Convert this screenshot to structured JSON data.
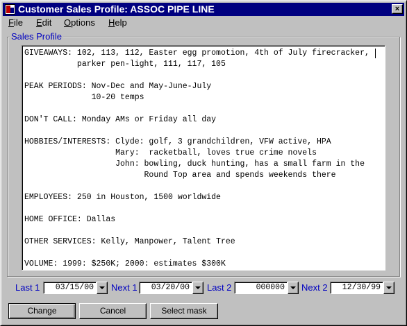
{
  "window": {
    "title": "Customer Sales Profile:  ASSOC PIPE LINE",
    "close_glyph": "×"
  },
  "menu": {
    "items": [
      {
        "label_u": "F",
        "label_rest": "ile"
      },
      {
        "label_u": "E",
        "label_rest": "dit"
      },
      {
        "label_u": "O",
        "label_rest": "ptions"
      },
      {
        "label_u": "H",
        "label_rest": "elp"
      }
    ]
  },
  "profile": {
    "group_label": "Sales Profile",
    "lines": [
      "GIVEAWAYS: 102, 113, 112, Easter egg promotion, 4th of July firecracker,",
      "           parker pen-light, 111, 117, 105",
      "",
      "PEAK PERIODS: Nov-Dec and May-June-July",
      "              10-20 temps",
      "",
      "DON'T CALL: Monday AMs or Friday all day",
      "",
      "HOBBIES/INTERESTS: Clyde: golf, 3 grandchildren, VFW active, HPA",
      "                   Mary:  racketball, loves true crime novels",
      "                   John: bowling, duck hunting, has a small farm in the",
      "                         Round Top area and spends weekends there",
      "",
      "EMPLOYEES: 250 in Houston, 1500 worldwide",
      "",
      "HOME OFFICE: Dallas",
      "",
      "OTHER SERVICES: Kelly, Manpower, Talent Tree",
      "",
      "VOLUME: 1999: $250K; 2000: estimates $300K"
    ]
  },
  "nav": {
    "last1": {
      "label": "Last 1",
      "value": "03/15/00"
    },
    "next1": {
      "label": "Next 1",
      "value": "03/20/00"
    },
    "last2": {
      "label": "Last 2",
      "value": "000000"
    },
    "next2": {
      "label": "Next 2",
      "value": "12/30/99"
    }
  },
  "buttons": {
    "change": "Change",
    "cancel": "Cancel",
    "select_mask": "Select mask"
  },
  "colors": {
    "titlebar": "#000080",
    "label_blue": "#0000c0",
    "face": "#c0c0c0"
  }
}
